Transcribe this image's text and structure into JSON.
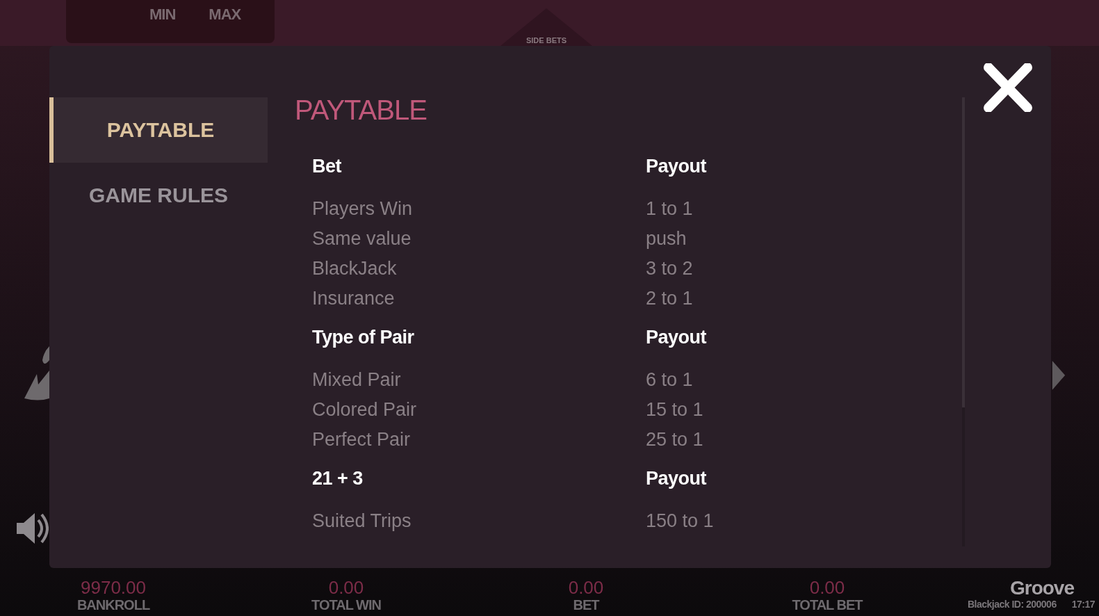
{
  "background": {
    "limits": [
      "MIN",
      "MAX"
    ],
    "side_bets_label": "SIDE BETS"
  },
  "menu": [
    {
      "label": "PAYTABLE",
      "selected": true
    },
    {
      "label": "GAME RULES",
      "selected": false
    }
  ],
  "title": "PAYTABLE",
  "sections": [
    {
      "header": [
        "Bet",
        "Payout"
      ],
      "rows": [
        [
          "Players Win",
          "1 to 1"
        ],
        [
          "Same value",
          "push"
        ],
        [
          "BlackJack",
          "3 to 2"
        ],
        [
          "Insurance",
          "2 to 1"
        ]
      ]
    },
    {
      "header": [
        "Type of Pair",
        "Payout"
      ],
      "rows": [
        [
          "Mixed Pair",
          "6 to 1"
        ],
        [
          "Colored Pair",
          "15 to 1"
        ],
        [
          "Perfect Pair",
          "25 to 1"
        ]
      ]
    },
    {
      "header": [
        "21 + 3",
        "Payout"
      ],
      "rows": [
        [
          "Suited Trips",
          "150 to 1"
        ]
      ]
    }
  ],
  "status_bar": {
    "items": [
      {
        "value": "9970.00",
        "label": "BANKROLL"
      },
      {
        "value": "0.00",
        "label": "TOTAL WIN"
      },
      {
        "value": "0.00",
        "label": "BET"
      },
      {
        "value": "0.00",
        "label": "TOTAL BET"
      }
    ],
    "brand": "Groove",
    "game_id": "Blackjack ID: 200006",
    "time": "17:17"
  }
}
